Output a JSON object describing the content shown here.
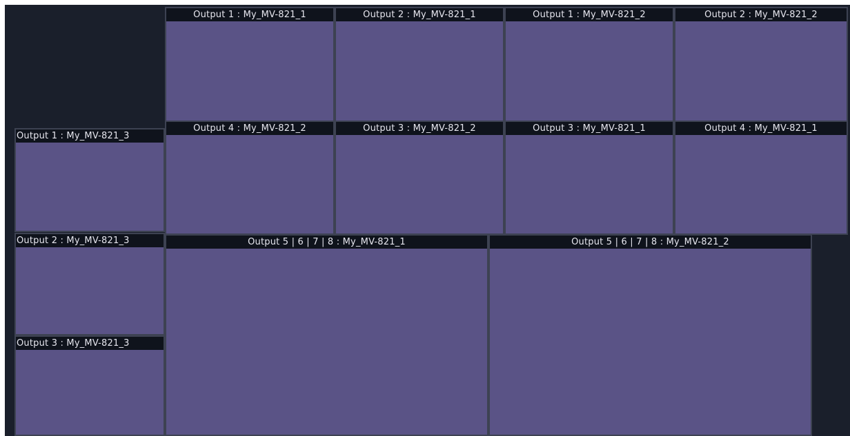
{
  "colors": {
    "canvas_background": "#1a1f2b",
    "tile_fill": "#5a5386",
    "tile_border": "#3d4252",
    "title_bar": "#0f131c",
    "title_text": "#e6e6ee"
  },
  "tiles": {
    "top_row": [
      {
        "title": "Output 1 : My_MV-821_1"
      },
      {
        "title": "Output 2 : My_MV-821_1"
      },
      {
        "title": "Output 1 : My_MV-821_2"
      },
      {
        "title": "Output 2 : My_MV-821_2"
      }
    ],
    "second_row": [
      {
        "title": "Output 4 : My_MV-821_2"
      },
      {
        "title": "Output 3 : My_MV-821_2"
      },
      {
        "title": "Output 3 : My_MV-821_1"
      },
      {
        "title": "Output 4 : My_MV-821_1"
      }
    ],
    "left_column": [
      {
        "title": "Output 1 : My_MV-821_3"
      },
      {
        "title": "Output 2 : My_MV-821_3"
      },
      {
        "title": "Output 3 : My_MV-821_3"
      }
    ],
    "large": [
      {
        "title": "Output 5 | 6 | 7 | 8 : My_MV-821_1"
      },
      {
        "title": "Output 5 | 6 | 7 | 8 : My_MV-821_2"
      }
    ]
  }
}
